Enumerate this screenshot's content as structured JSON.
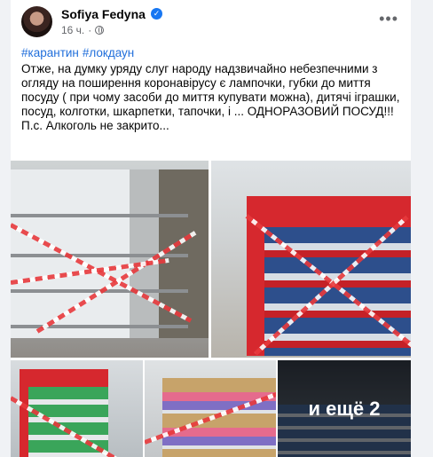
{
  "post": {
    "author": "Sofiya Fedyna",
    "time": "16 ч.",
    "hashtags": [
      "#карантин",
      "#локдаун"
    ],
    "body": "Отже, на думку уряду слуг народу надзвичайно небезпечними з огляду на поширення коронавірусу є лампочки, губки до миття посуду ( при чому засоби до миття купувати можна), дитячі іграшки, посуд, колготки, шкарпетки, тапочки, і ... ОДНОРАЗОВИЙ ПОСУД!!!",
    "ps": "П.с. Алкоголь не закрито...",
    "more_photos_label": "и ещё 2"
  },
  "icons": {
    "verified": "verified-badge-icon",
    "audience": "globe-icon",
    "options": "more-options-icon"
  },
  "colors": {
    "link": "#216fdb",
    "verified": "#1877f2",
    "tape_red": "#e8393c",
    "shelf_red": "#c42127"
  }
}
